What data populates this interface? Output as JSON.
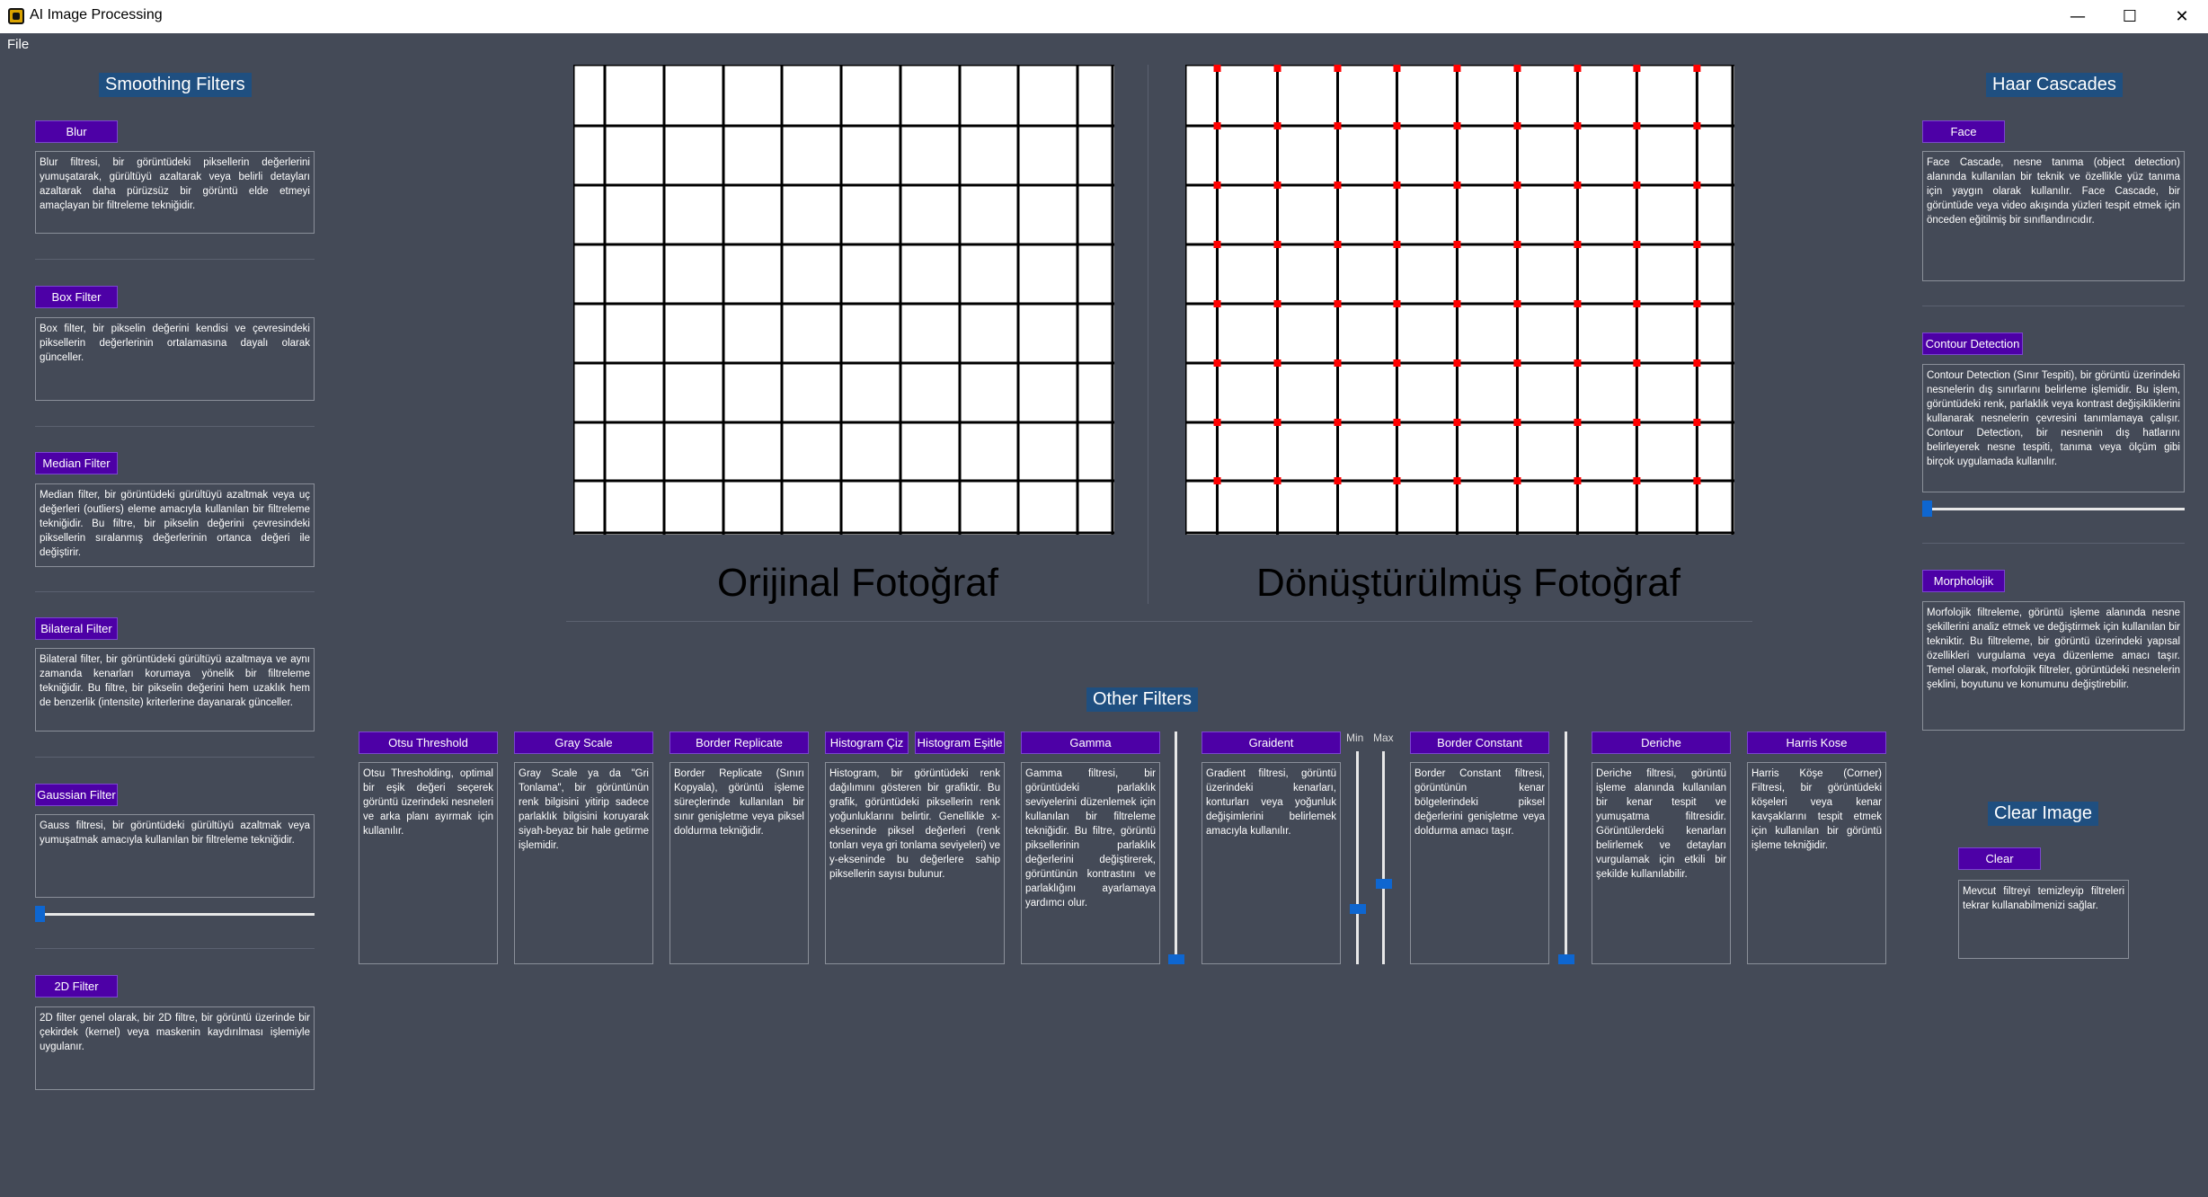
{
  "window": {
    "title": "AI Image Processing",
    "minimize_glyph": "—",
    "maximize_glyph": "☐",
    "close_glyph": "✕"
  },
  "menu": {
    "file_label": "File"
  },
  "smoothing": {
    "title": "Smoothing Filters",
    "items": [
      {
        "label": "Blur",
        "desc": "Blur filtresi, bir görüntüdeki piksellerin değerlerini yumuşatarak, gürültüyü azaltarak veya belirli detayları azaltarak daha pürüzsüz bir görüntü elde etmeyi amaçlayan bir filtreleme tekniğidir."
      },
      {
        "label": "Box Filter",
        "desc": "Box filter, bir pikselin değerini kendisi ve çevresindeki piksellerin değerlerinin ortalamasına dayalı olarak günceller."
      },
      {
        "label": "Median Filter",
        "desc": "Median filter, bir görüntüdeki gürültüyü azaltmak veya uç değerleri (outliers) eleme amacıyla kullanılan bir filtreleme tekniğidir. Bu filtre, bir pikselin değerini çevresindeki piksellerin sıralanmış değerlerinin ortanca değeri ile değiştirir."
      },
      {
        "label": "Bilateral Filter",
        "desc": "Bilateral filter, bir görüntüdeki gürültüyü azaltmaya ve aynı zamanda kenarları korumaya yönelik bir filtreleme tekniğidir. Bu filtre, bir pikselin değerini hem uzaklık hem de benzerlik (intensite) kriterlerine dayanarak günceller."
      },
      {
        "label": "Gaussian Filter",
        "desc": "Gauss filtresi, bir görüntüdeki gürültüyü azaltmak veya yumuşatmak amacıyla kullanılan bir filtreleme tekniğidir."
      },
      {
        "label": "2D Filter",
        "desc": "2D filter genel olarak, bir 2D filtre, bir görüntü üzerinde bir çekirdek (kernel) veya maskenin kaydırılması işlemiyle uygulanır."
      }
    ],
    "gaussian_slider_value": 0
  },
  "images": {
    "original_caption": "Orijinal Fotoğraf",
    "transformed_caption": "Dönüştürülmüş Fotoğraf",
    "grid_color": "#000000",
    "corner_marker_color": "#ff0000"
  },
  "other": {
    "title": "Other Filters",
    "otsu": {
      "label": "Otsu Threshold",
      "desc": "Otsu Thresholding, optimal bir eşik değeri seçerek görüntü üzerindeki nesneleri ve arka planı ayırmak için kullanılır."
    },
    "gray": {
      "label": "Gray Scale",
      "desc": "Gray Scale ya da \"Gri Tonlama\", bir görüntünün renk bilgisini yitirip sadece parlaklık bilgisini koruyarak siyah-beyaz bir hale getirme işlemidir."
    },
    "border_replicate": {
      "label": "Border Replicate",
      "desc": "Border Replicate (Sınırı Kopyala), görüntü işleme süreçlerinde kullanılan bir sınır genişletme veya piksel doldurma tekniğidir."
    },
    "histogram": {
      "label_draw": "Histogram Çiz",
      "label_eq": "Histogram Eşitle",
      "desc": "Histogram, bir görüntüdeki renk dağılımını gösteren bir grafiktir. Bu grafik, görüntüdeki piksellerin renk yoğunluklarını belirtir. Genellikle x-ekseninde piksel değerleri (renk tonları veya gri tonlama seviyeleri) ve y-ekseninde bu değerlere sahip piksellerin sayısı bulunur."
    },
    "gamma": {
      "label": "Gamma",
      "desc": "Gamma filtresi, bir görüntüdeki parlaklık seviyelerini düzenlemek için kullanılan bir filtreleme tekniğidir. Bu filtre, görüntü piksellerinin parlaklık değerlerini değiştirerek, görüntünün kontrastını ve parlaklığını ayarlamaya yardımcı olur.",
      "slider_value": 0
    },
    "gradient": {
      "label": "Graident",
      "desc": "Gradient filtresi, görüntü üzerindeki kenarları, konturları veya yoğunluk değişimlerini belirlemek amacıyla kullanılır.",
      "min_label": "Min",
      "max_label": "Max",
      "min_value": 0.25,
      "max_value": 0.37
    },
    "border_constant": {
      "label": "Border Constant",
      "desc": "Border Constant filtresi, görüntünün kenar bölgelerindeki piksel değerlerini genişletme veya doldurma amacı taşır.",
      "slider_value": 0
    },
    "deriche": {
      "label": "Deriche",
      "desc": "Deriche filtresi, görüntü işleme alanında kullanılan bir kenar tespit ve yumuşatma filtresidir. Görüntülerdeki kenarları belirlemek ve detayları vurgulamak için etkili bir şekilde kullanılabilir."
    },
    "harris": {
      "label": "Harris Kose",
      "desc": "Harris Köşe (Corner) Filtresi, bir görüntüdeki köşeleri veya kenar kavşaklarını tespit etmek için kullanılan bir görüntü işleme tekniğidir."
    }
  },
  "haar": {
    "title": "Haar Cascades",
    "face": {
      "label": "Face",
      "desc": "Face Cascade, nesne tanıma (object detection) alanında kullanılan bir teknik ve özellikle yüz tanıma için yaygın olarak kullanılır. Face Cascade, bir görüntüde veya video akışında yüzleri tespit etmek için önceden eğitilmiş bir sınıflandırıcıdır."
    },
    "contour": {
      "label": "Contour Detection",
      "desc": "Contour Detection (Sınır Tespiti), bir görüntü üzerindeki nesnelerin dış sınırlarını belirleme işlemidir. Bu işlem, görüntüdeki renk, parlaklık veya kontrast değişikliklerini kullanarak nesnelerin çevresini tanımlamaya çalışır. Contour Detection, bir nesnenin dış hatlarını belirleyerek nesne tespiti, tanıma veya ölçüm gibi birçok uygulamada kullanılır.",
      "slider_value": 0
    },
    "morph": {
      "label": "Morpholojik",
      "desc": "Morfolojik filtreleme, görüntü işleme alanında nesne şekillerini analiz etmek ve değiştirmek için kullanılan bir tekniktir. Bu filtreleme, bir görüntü üzerindeki yapısal özellikleri vurgulama veya düzenleme amacı taşır. Temel olarak, morfolojik filtreler, görüntüdeki nesnelerin şeklini, boyutunu ve konumunu değiştirebilir."
    }
  },
  "clear": {
    "title": "Clear Image",
    "label": "Clear",
    "desc": "Mevcut filtreyi temizleyip filtreleri tekrar kullanabilmenizi sağlar."
  }
}
